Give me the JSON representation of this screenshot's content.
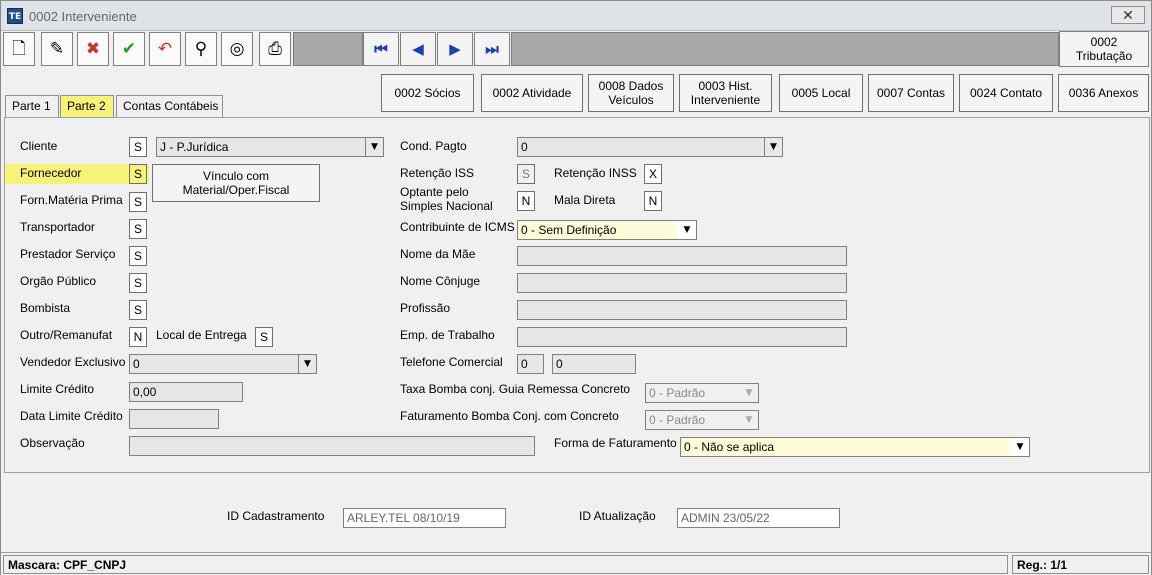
{
  "window": {
    "app_icon": "TE",
    "title": "0002 Interveniente",
    "close": "✕"
  },
  "toolbar": {
    "icons": [
      "new-document-icon",
      "edit-icon",
      "cancel-icon",
      "confirm-check-icon",
      "undo-icon",
      "binoculars-search-icon",
      "disk-tool-icon",
      "print-icon"
    ],
    "nav": [
      "⏮",
      "◀",
      "▶",
      "⏭"
    ],
    "tributacao": [
      "0002",
      "Tributação"
    ]
  },
  "actions": {
    "socios": "0002 Sócios",
    "atividade": "0002 Atividade",
    "veiculos": [
      "0008 Dados",
      "Veículos"
    ],
    "hist": [
      "0003 Hist.",
      "Interveniente"
    ],
    "local": "0005 Local",
    "contas": "0007 Contas",
    "contato": "0024 Contato",
    "anexos": "0036 Anexos"
  },
  "tabs": [
    "Parte 1",
    "Parte 2",
    "Contas Contábeis"
  ],
  "left": {
    "cliente": {
      "label": "Cliente",
      "flag": "S",
      "tipo": "J - P.Jurídica"
    },
    "fornecedor": {
      "label": "Fornecedor",
      "flag": "S"
    },
    "vinculo": [
      "Vínculo com",
      "Material/Oper.Fiscal"
    ],
    "materia_prima": {
      "label": "Forn.Matéria Prima",
      "flag": "S"
    },
    "transportador": {
      "label": "Transportador",
      "flag": "S"
    },
    "prestador": {
      "label": "Prestador Serviço",
      "flag": "S"
    },
    "orgao": {
      "label": "Orgão Público",
      "flag": "S"
    },
    "bombista": {
      "label": "Bombista",
      "flag": "S"
    },
    "outro": {
      "label": "Outro/Remanufat",
      "flag": "N"
    },
    "local_entrega": {
      "label": "Local de Entrega",
      "flag": "S"
    },
    "vendedor": {
      "label": "Vendedor Exclusivo",
      "value": "0"
    },
    "limite": {
      "label": "Limite Crédito",
      "value": "0,00"
    },
    "data_limite": {
      "label": "Data Limite Crédito",
      "value": ""
    },
    "observacao": {
      "label": "Observação",
      "value": ""
    }
  },
  "right": {
    "cond_pagto": {
      "label": "Cond. Pagto",
      "value": "0"
    },
    "ret_iss": {
      "label": "Retenção ISS",
      "flag": "S"
    },
    "ret_inss": {
      "label": "Retenção INSS",
      "flag": "X"
    },
    "optante": {
      "label": [
        "Optante pelo",
        "Simples Nacional"
      ],
      "flag": "N"
    },
    "mala": {
      "label": "Mala Direta",
      "flag": "N"
    },
    "icms": {
      "label": "Contribuinte de ICMS",
      "value": "0 - Sem Definição"
    },
    "mae": {
      "label": "Nome da Mãe",
      "value": ""
    },
    "conjuge": {
      "label": "Nome Cônjuge",
      "value": ""
    },
    "profissao": {
      "label": "Profissão",
      "value": ""
    },
    "emp": {
      "label": "Emp. de Trabalho",
      "value": ""
    },
    "telefone": {
      "label": "Telefone Comercial",
      "ddd": "0",
      "numero": "0"
    },
    "taxa_bomba": {
      "label": "Taxa Bomba conj. Guia Remessa Concreto",
      "value": "0 - Padrão"
    },
    "fat_bomba": {
      "label": "Faturamento Bomba Conj. com Concreto",
      "value": "0 - Padrão"
    },
    "forma_fat": {
      "label": "Forma de Faturamento",
      "value": "0 - Não se aplica"
    }
  },
  "audit": {
    "cad_label": "ID Cadastramento",
    "cad_value": "ARLEY.TEL 08/10/19",
    "atu_label": "ID Atualização",
    "atu_value": "ADMIN 23/05/22"
  },
  "status": {
    "mascara": "Mascara: CPF_CNPJ",
    "reg": "Reg.: 1/1"
  },
  "colors": {
    "highlight": "#f7f27a",
    "field_bg": "#e6e6e6",
    "nav_blue": "#1a3fae"
  }
}
